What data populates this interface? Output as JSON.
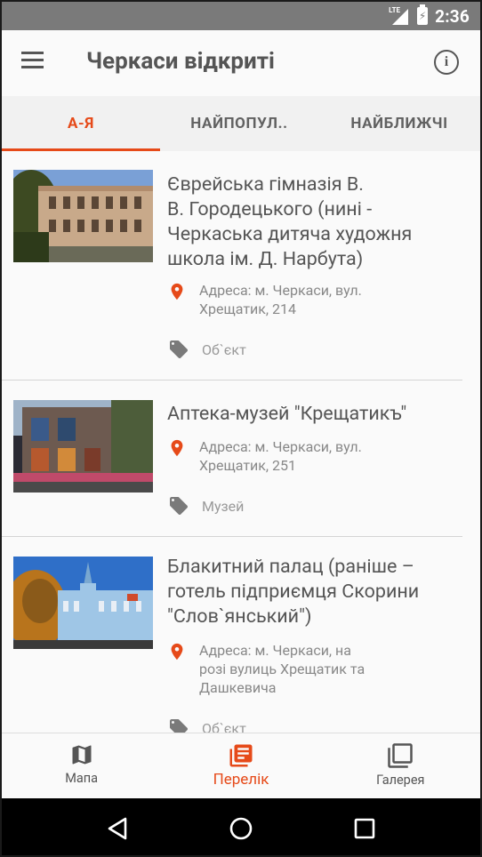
{
  "status_bar": {
    "network": "LTE",
    "time": "2:36"
  },
  "app": {
    "title": "Черкаси відкриті"
  },
  "tabs": [
    {
      "label": "А-Я",
      "active": true
    },
    {
      "label": "НАЙПОПУЛ..",
      "active": false
    },
    {
      "label": "НАЙБЛИЖЧІ",
      "active": false
    }
  ],
  "items": [
    {
      "title": "Єврейська гімназія В. В. Городецького (нині - Черкаська дитяча художня школа ім. Д. Нарбута)",
      "title_lines": [
        "Єврейська гімназія В.",
        "В. Городецького (нині -",
        "Черкаська дитяча художня",
        "школа ім. Д. Нарбута)"
      ],
      "address_lines": [
        "Адреса: м. Черкаси, вул.",
        "Хрещатик, 214"
      ],
      "category": "Об`єкт"
    },
    {
      "title": "Аптека-музей \"Крещатикъ\"",
      "title_lines": [
        "Аптека-музей \"Крещатикъ\""
      ],
      "address_lines": [
        "Адреса: м. Черкаси, вул.",
        "Хрещатик, 251"
      ],
      "category": "Музей"
    },
    {
      "title": "Блакитний палац (раніше – готель підприємця Скорини \"Слов`янський\")",
      "title_lines": [
        "Блакитний палац (раніше –",
        "готель підприємця Скорини",
        "\"Слов`янський\")"
      ],
      "address_lines": [
        "Адреса: м. Черкаси, на",
        "розі вулиць Хрещатик та",
        "Дашкевича"
      ],
      "category": "Об`єкт"
    }
  ],
  "bottom_nav": [
    {
      "label": "Мапа",
      "icon": "map-icon",
      "active": false
    },
    {
      "label": "Перелік",
      "icon": "list-icon",
      "active": true
    },
    {
      "label": "Галерея",
      "icon": "gallery-icon",
      "active": false
    }
  ],
  "colors": {
    "accent": "#e64a19",
    "text": "#555555",
    "status_bar": "#7a7a7a"
  }
}
